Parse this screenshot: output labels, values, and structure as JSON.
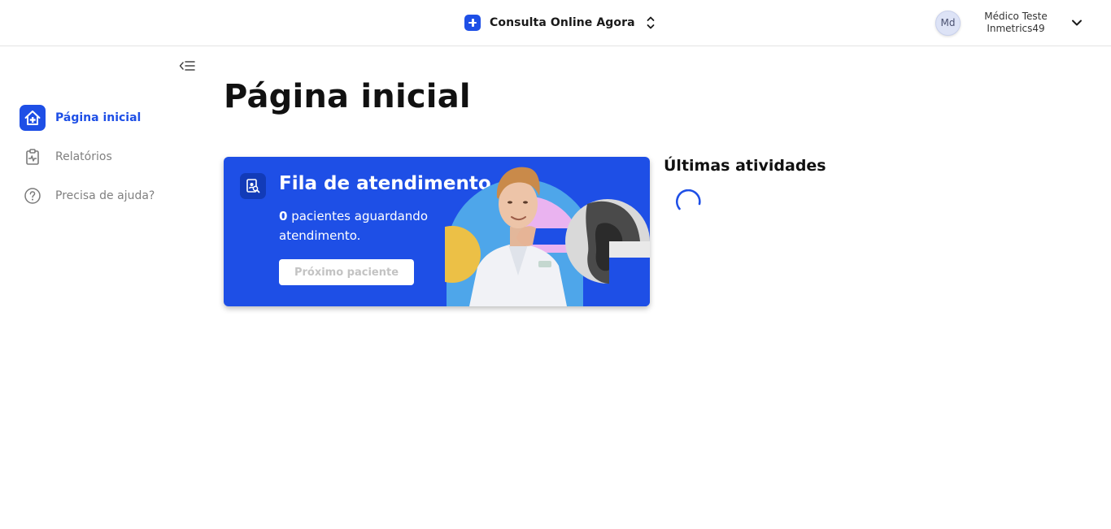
{
  "header": {
    "app_name": "Consulta Online Agora",
    "app_icon": "plus-square-icon",
    "user": {
      "initials": "Md",
      "name": "Médico Teste",
      "org": "Inmetrics49"
    }
  },
  "sidebar": {
    "items": [
      {
        "label": "Página inicial",
        "icon": "home-plus-icon",
        "active": true
      },
      {
        "label": "Relatórios",
        "icon": "report-clipboard-icon",
        "active": false
      },
      {
        "label": "Precisa de ajuda?",
        "icon": "help-circle-icon",
        "active": false
      }
    ]
  },
  "main": {
    "title": "Página inicial",
    "queue_card": {
      "title": "Fila de atendimento",
      "count": "0",
      "desc_suffix": " pacientes aguardando atendimento.",
      "button_label": "Próximo paciente"
    },
    "activities": {
      "title": "Últimas atividades",
      "loading": true
    }
  },
  "colors": {
    "primary": "#1e4fe6",
    "primary_dark": "#123bb8",
    "muted_text": "#808080",
    "illustration_yellow": "#ecc046",
    "illustration_pink": "#eab3f0",
    "illustration_lightblue": "#4ea6ea"
  }
}
